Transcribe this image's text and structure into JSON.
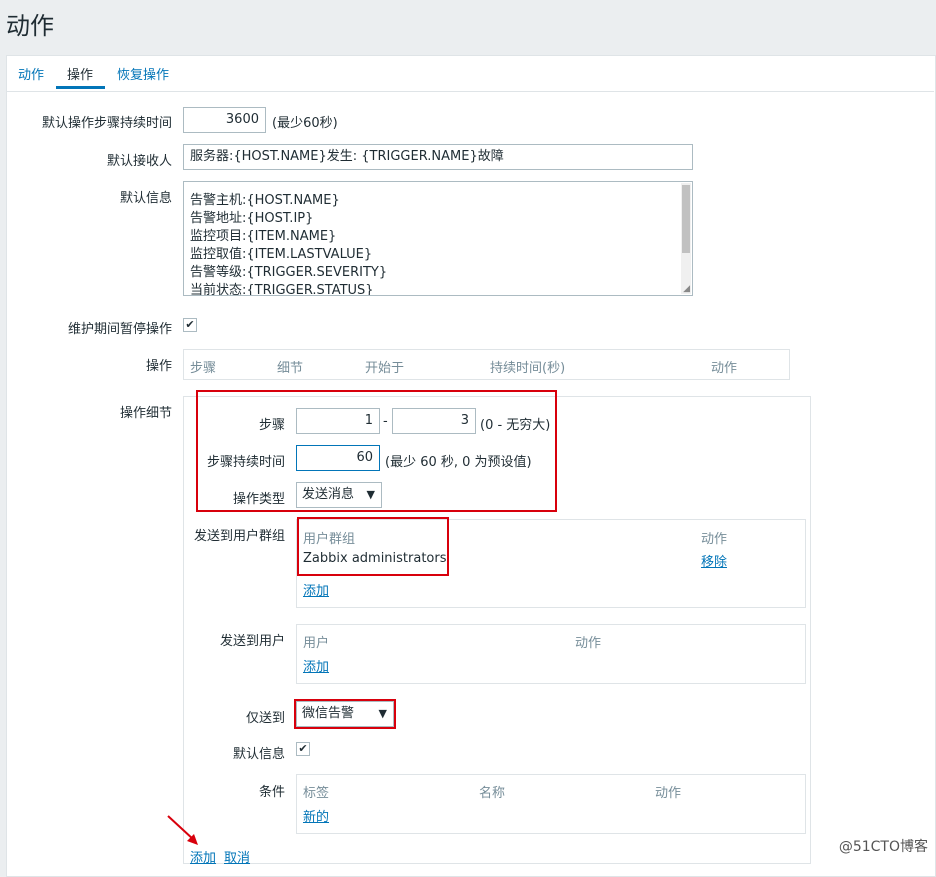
{
  "page": {
    "title": "动作"
  },
  "tabs": [
    {
      "label": "动作"
    },
    {
      "label": "操作"
    },
    {
      "label": "恢复操作"
    }
  ],
  "form": {
    "step_duration_label": "默认操作步骤持续时间",
    "step_duration_value": "3600",
    "step_duration_hint": "(最少60秒)",
    "recipient_label": "默认接收人",
    "recipient_value": "服务器:{HOST.NAME}发生: {TRIGGER.NAME}故障",
    "message_label": "默认信息",
    "message_lines": [
      "告警主机:{HOST.NAME}",
      "告警地址:{HOST.IP}",
      "监控项目:{ITEM.NAME}",
      "监控取值:{ITEM.LASTVALUE}",
      "告警等级:{TRIGGER.SEVERITY}",
      "当前状态:{TRIGGER.STATUS}"
    ],
    "pause_label": "维护期间暂停操作",
    "pause_checked": true,
    "operations_label": "操作",
    "operations_columns": [
      "步骤",
      "细节",
      "开始于",
      "持续时间(秒)",
      "动作"
    ]
  },
  "details": {
    "label": "操作细节",
    "steps_label": "步骤",
    "step_from": "1",
    "step_sep": "-",
    "step_to": "3",
    "step_hint": "(0 - 无穷大)",
    "duration_label": "步骤持续时间",
    "duration_value": "60",
    "duration_hint": "(最少 60 秒, 0 为预设值)",
    "optype_label": "操作类型",
    "optype_value": "发送消息",
    "usergroup_label": "发送到用户群组",
    "usergroup_col": "用户群组",
    "usergroup_action_col": "动作",
    "usergroup_row": "Zabbix administrators",
    "usergroup_remove": "移除",
    "usergroup_add": "添加",
    "users_label": "发送到用户",
    "users_col": "用户",
    "users_action_col": "动作",
    "users_add": "添加",
    "sendonly_label": "仅送到",
    "sendonly_value": "微信告警",
    "defmsg_label": "默认信息",
    "defmsg_checked": true,
    "cond_label": "条件",
    "cond_cols": [
      "标签",
      "名称",
      "动作"
    ],
    "cond_new": "新的",
    "add": "添加",
    "cancel": "取消"
  },
  "watermark": "@51CTO博客",
  "colors": {
    "accent": "#0275b8",
    "highlight": "#d8000c"
  },
  "icons": {
    "checkbox": "check-icon",
    "select": "triangle-down-icon",
    "annotation": "red-arrow-icon"
  }
}
